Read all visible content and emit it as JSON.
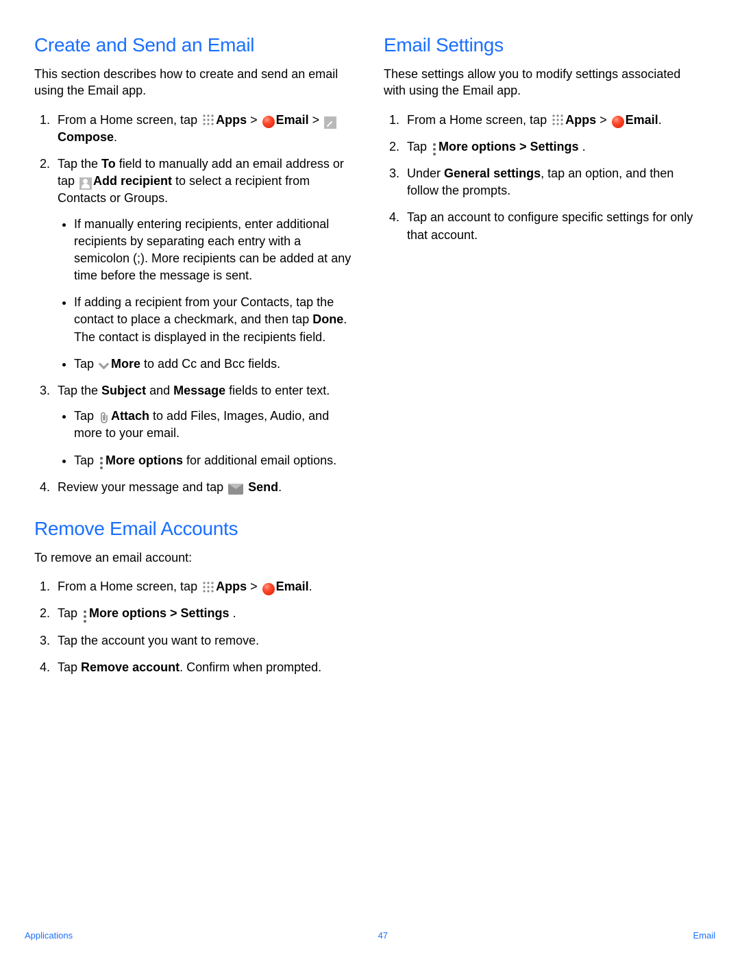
{
  "left": {
    "section1": {
      "heading": "Create and Send an Email",
      "intro": "This section describes how to create and send an email using the Email app.",
      "s1_pre": "From a Home screen, tap ",
      "apps_b": "Apps",
      "gt": " > ",
      "email_b": "Email",
      "s1_post": " > ",
      "compose_b": "Compose",
      "s1_end": ".",
      "s2_a": "Tap the ",
      "s2_to": "To",
      "s2_b": " field to manually add an email address or tap ",
      "s2_add": "Add recipient",
      "s2_c": " to select a recipient from Contacts or Groups.",
      "s2_bul1": "If manually entering recipients, enter additional recipients by separating each entry with a semicolon (;). More recipients can be added at any time before the message is sent.",
      "s2_bul2_a": "If adding a recipient from your Contacts, tap the contact to place a checkmark, and then tap ",
      "s2_bul2_done": "Done",
      "s2_bul2_b": ". The contact is displayed in the recipients field.",
      "s2_bul3_a": "Tap ",
      "s2_bul3_more": "More",
      "s2_bul3_b": " to add Cc and Bcc fields.",
      "s3_a": "Tap the ",
      "s3_subj": "Subject",
      "s3_and": " and ",
      "s3_msg": "Message",
      "s3_b": " fields to enter text.",
      "s3_bul1_a": "Tap ",
      "s3_bul1_attach": "Attach",
      "s3_bul1_b": " to add Files, Images, Audio, and more to your email.",
      "s3_bul2_a": "Tap ",
      "s3_bul2_more": "More options",
      "s3_bul2_b": " for additional email options.",
      "s4_a": "Review your message and tap ",
      "s4_send": " Send",
      "s4_b": "."
    },
    "section2": {
      "heading": "Remove Email Accounts",
      "intro": "To remove an email account:",
      "s1_pre": "From a Home screen, tap ",
      "apps_b": "Apps",
      "gt": " >  ",
      "email_b": "Email",
      "s1_end": ".",
      "s2_a": "Tap ",
      "s2_more": "More options",
      "s2_gt": " > ",
      "s2_set": "Settings",
      "s2_end": " .",
      "s3": "Tap the account you want to remove.",
      "s4_a": "Tap ",
      "s4_rem": "Remove account",
      "s4_b": ". Confirm when prompted."
    }
  },
  "right": {
    "heading": "Email Settings",
    "intro": "These settings allow you to modify settings associated with using the Email app.",
    "s1_pre": "From a Home screen, tap ",
    "apps_b": "Apps",
    "gt": " > ",
    "email_b": "Email",
    "s1_end": ".",
    "s2_a": "Tap ",
    "s2_more": "More options",
    "s2_gt": " > ",
    "s2_set": "Settings",
    "s2_end": " .",
    "s3_a": "Under ",
    "s3_gen": "General settings",
    "s3_b": ", tap an option, and then follow the prompts.",
    "s4": "Tap an account to configure specific settings for only that account."
  },
  "footer": {
    "left": "Applications",
    "center": "47",
    "right": "Email"
  }
}
